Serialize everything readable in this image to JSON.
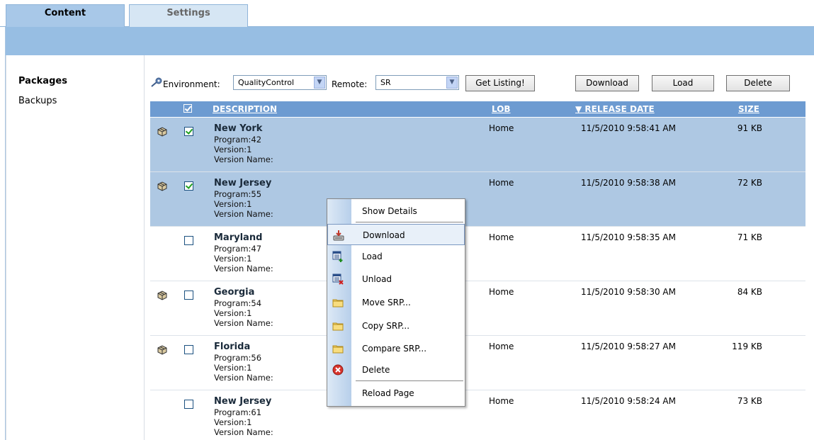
{
  "tabs": [
    {
      "label": "Content",
      "active": true
    },
    {
      "label": "Settings",
      "active": false
    }
  ],
  "sidebar": {
    "items": [
      {
        "label": "Packages",
        "active": true
      },
      {
        "label": "Backups",
        "active": false
      }
    ]
  },
  "toolbar": {
    "environment_label": "Environment:",
    "environment_value": "QualityControl",
    "remote_label": "Remote:",
    "remote_value": "SR",
    "get_listing_label": "Get Listing!",
    "download_label": "Download",
    "load_label": "Load",
    "delete_label": "Delete"
  },
  "grid": {
    "columns": {
      "description": "DESCRIPTION",
      "lob": "LOB",
      "release_date": "▼ RELEASE DATE",
      "size": "SIZE"
    },
    "rows": [
      {
        "title": "New York",
        "program": "Program:42",
        "version": "Version:1",
        "version_name": "Version Name:",
        "lob": "Home",
        "date": "11/5/2010 9:58:41 AM",
        "size": "91 KB",
        "checked": true,
        "selected": true,
        "has_icon": true
      },
      {
        "title": "New Jersey",
        "program": "Program:55",
        "version": "Version:1",
        "version_name": "Version Name:",
        "lob": "Home",
        "date": "11/5/2010 9:58:38 AM",
        "size": "72 KB",
        "checked": true,
        "selected": true,
        "has_icon": true
      },
      {
        "title": "Maryland",
        "program": "Program:47",
        "version": "Version:1",
        "version_name": "Version Name:",
        "lob": "Home",
        "date": "11/5/2010 9:58:35 AM",
        "size": "71 KB",
        "checked": false,
        "selected": false,
        "has_icon": false
      },
      {
        "title": "Georgia",
        "program": "Program:54",
        "version": "Version:1",
        "version_name": "Version Name:",
        "lob": "Home",
        "date": "11/5/2010 9:58:30 AM",
        "size": "84 KB",
        "checked": false,
        "selected": false,
        "has_icon": true
      },
      {
        "title": "Florida",
        "program": "Program:56",
        "version": "Version:1",
        "version_name": "Version Name:",
        "lob": "Home",
        "date": "11/5/2010 9:58:27 AM",
        "size": "119 KB",
        "checked": false,
        "selected": false,
        "has_icon": true
      },
      {
        "title": "New Jersey",
        "program": "Program:61",
        "version": "Version:1",
        "version_name": "Version Name:",
        "lob": "Home",
        "date": "11/5/2010 9:58:24 AM",
        "size": "73 KB",
        "checked": false,
        "selected": false,
        "has_icon": false
      }
    ]
  },
  "context_menu": {
    "items": [
      {
        "label": "Show Details",
        "icon": "none"
      },
      {
        "label": "Download",
        "icon": "download-icon",
        "highlighted": true
      },
      {
        "label": "Load",
        "icon": "load-icon"
      },
      {
        "label": "Unload",
        "icon": "unload-icon"
      },
      {
        "label": "Move SRP...",
        "icon": "folder-icon"
      },
      {
        "label": "Copy SRP...",
        "icon": "folder-icon"
      },
      {
        "label": "Compare SRP...",
        "icon": "folder-icon"
      },
      {
        "label": "Delete",
        "icon": "delete-icon"
      },
      {
        "label": "Reload Page",
        "icon": "none"
      }
    ]
  },
  "colors": {
    "header_blue": "#6d9bd1",
    "band_blue": "#97bee3",
    "selected_row": "#aec8e3"
  }
}
